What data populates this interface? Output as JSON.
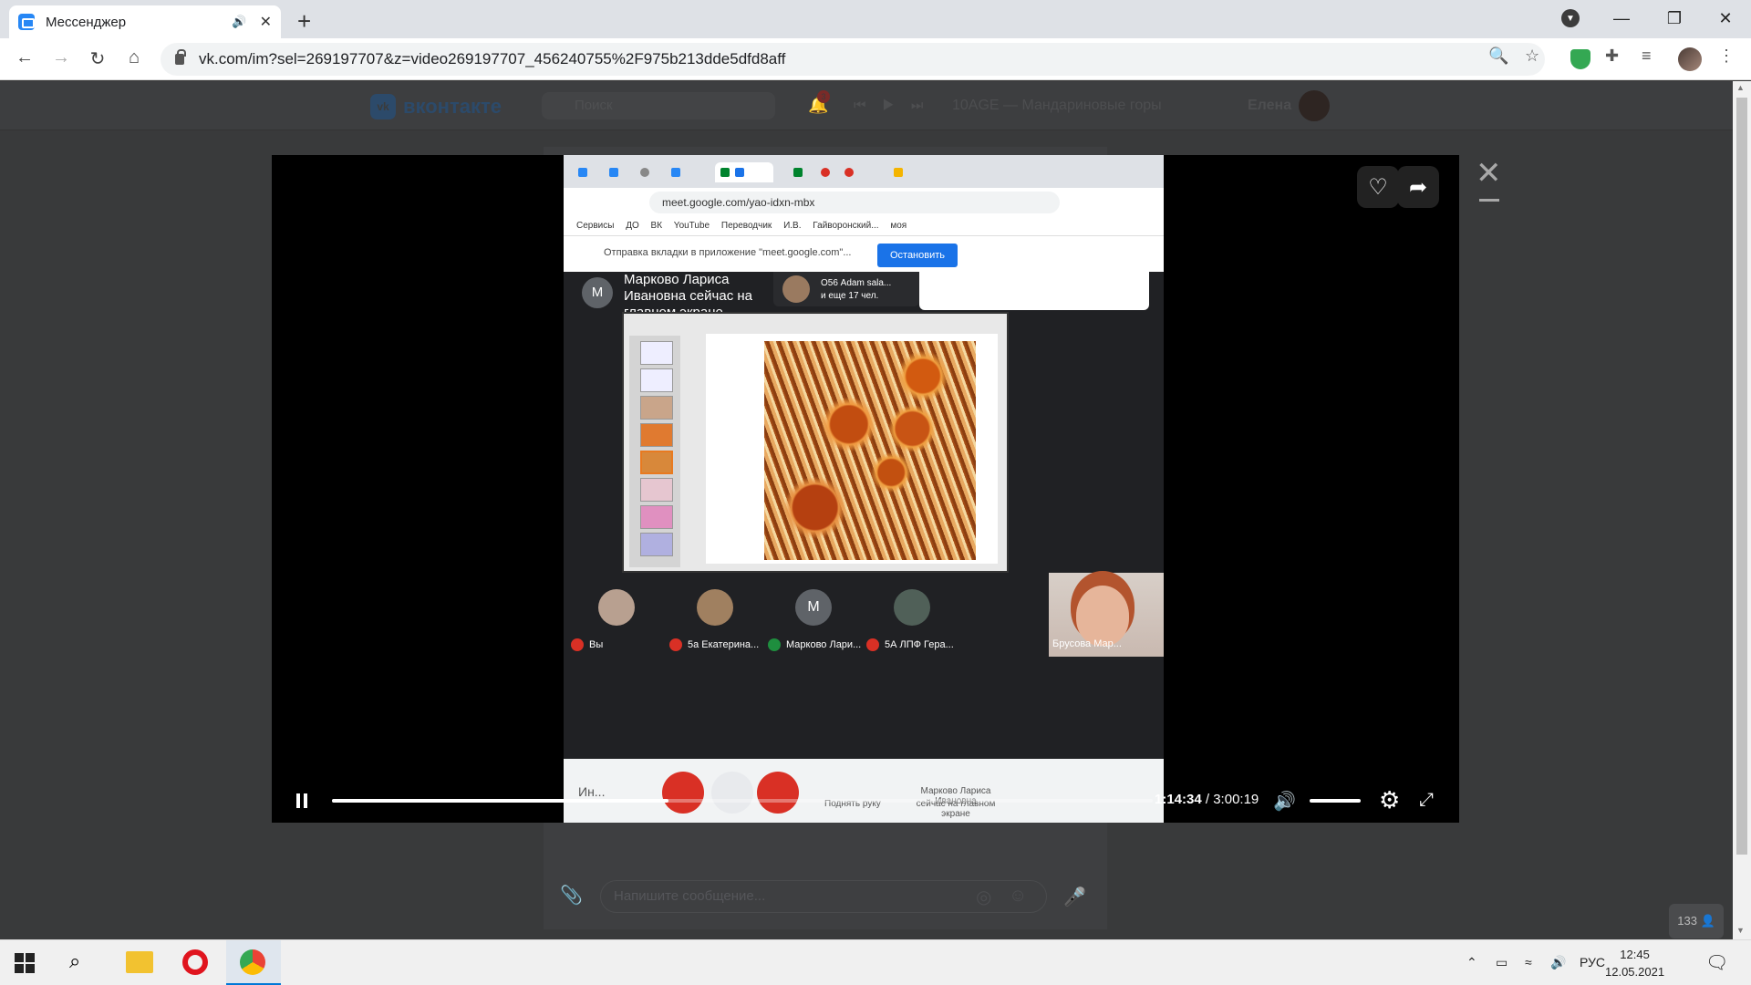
{
  "browser": {
    "tab_title": "Мессенджер",
    "url": "vk.com/im?sel=269197707&z=video269197707_456240755%2F975b213dde5dfd8aff"
  },
  "vk": {
    "logo": "вконтакте",
    "search_placeholder": "Поиск",
    "notif_count": "3",
    "track": "10AGE — Мандариновые горы",
    "user_name": "Елена",
    "composer_placeholder": "Напишите сообщение...",
    "viewers": "133"
  },
  "video": {
    "inner_url": "meet.google.com/yao-idxn-mbx",
    "bookmarks": "Сервисы ДО ВК YouTube Переводчик И.В. Гайворонский... моя",
    "share_msg": "Отправка вкладки в приложение \"meet.google.com\"...",
    "share_btn": "Остановить",
    "presenter": "Марково Лариса Ивановна сейчас на главном экране",
    "presenter_initial": "М",
    "pill_line1": "О56 Adam sala...",
    "pill_line2": "и еще 17 чел.",
    "participants": [
      {
        "name": "Вы"
      },
      {
        "name": "5а Екатерина..."
      },
      {
        "name": "Марково Лари..."
      },
      {
        "name": "5А ЛПФ Гера..."
      },
      {
        "name": "Брусова Мар..."
      }
    ],
    "ctrl_label": "Ин...",
    "raise_hand": "Поднять руку",
    "present_label": "Марково Лариса Ивановна",
    "present_sub": "сейчас на главном экране",
    "time_current": "1:14:34",
    "time_total": "3:00:19",
    "progress_fraction": 0.41
  },
  "taskbar": {
    "lang": "РУС",
    "time": "12:45",
    "date": "12.05.2021"
  }
}
